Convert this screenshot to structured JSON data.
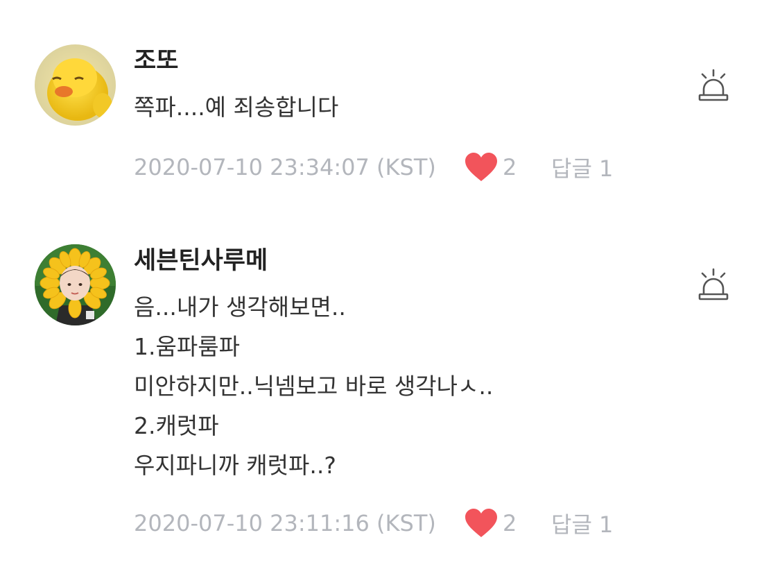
{
  "comments": [
    {
      "nickname": "조또",
      "lines": [
        "쪽파....예 죄송합니다"
      ],
      "timestamp": "2020-07-10 23:34:07 (KST)",
      "likes": "2",
      "reply_label": "답글 1",
      "avatar_icon": "duckling-avatar-icon",
      "report_icon": "siren-icon"
    },
    {
      "nickname": "세븐틴사루메",
      "lines": [
        "음...내가 생각해보면..",
        "1.움파룸파",
        "미안하지만..닉넴보고 바로 생각나ㅅ..",
        "2.캐럿파",
        "우지파니까 캐럿파..?"
      ],
      "timestamp": "2020-07-10 23:11:16 (KST)",
      "likes": "2",
      "reply_label": "답글 1",
      "avatar_icon": "sunflower-avatar-icon",
      "report_icon": "siren-icon"
    }
  ],
  "colors": {
    "heart": "#f2545b",
    "meta_text": "#b3b6bc",
    "nickname": "#222222",
    "body": "#333333",
    "icon_stroke": "#555555"
  }
}
